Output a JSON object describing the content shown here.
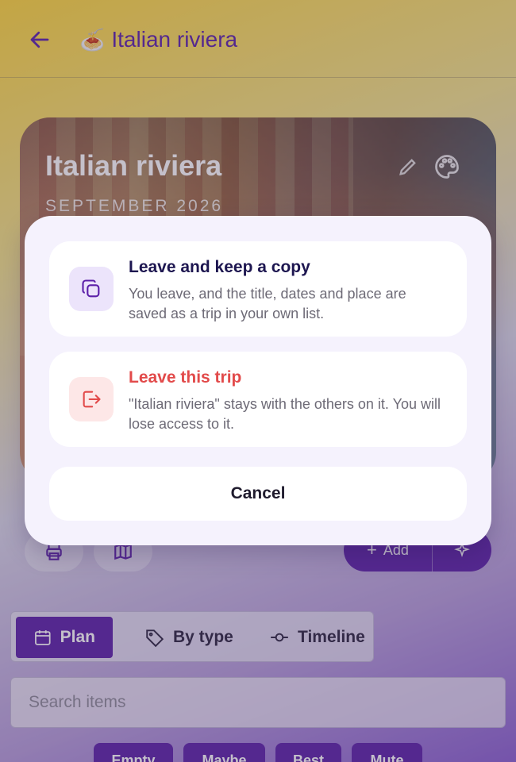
{
  "header": {
    "emoji": "🍝",
    "title": "Italian riviera"
  },
  "hero": {
    "title": "Italian riviera",
    "date": "SEPTEMBER 2026"
  },
  "actions": {
    "add_label": "Add"
  },
  "view_tabs": [
    {
      "label": "Plan",
      "icon": "calendar-icon",
      "active": true
    },
    {
      "label": "By type",
      "icon": "tag-icon",
      "active": false
    },
    {
      "label": "Timeline",
      "icon": "timeline-icon",
      "active": false
    }
  ],
  "search": {
    "placeholder": "Search items"
  },
  "chips": [
    "Empty",
    "Maybe",
    "Best",
    "Mute"
  ],
  "dialog": {
    "copy_option": {
      "title": "Leave and keep a copy",
      "description": "You leave, and the title, dates and place are saved as a trip in your own list.",
      "icon": "copy-icon"
    },
    "leave_option": {
      "title": "Leave this trip",
      "description": "\"Italian riviera\" stays with the others on it. You will lose access to it.",
      "icon": "leave-icon"
    },
    "cancel_label": "Cancel"
  },
  "colors": {
    "accent": "#5b1fa8",
    "danger": "#e24a4a",
    "dialog_bg": "#f5f2fd"
  }
}
